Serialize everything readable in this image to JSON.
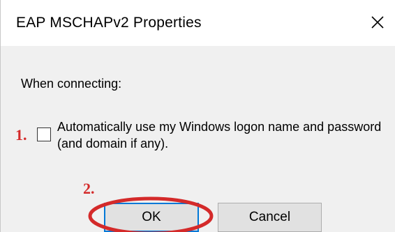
{
  "window": {
    "title": "EAP MSCHAPv2 Properties",
    "close_icon": "close-icon"
  },
  "section": {
    "label": "When connecting:"
  },
  "checkbox": {
    "label": "Automatically use my Windows logon name and password (and domain if any).",
    "checked": false
  },
  "annotations": {
    "step1": "1.",
    "step2": "2.",
    "color": "#d42a2a"
  },
  "buttons": {
    "ok_label": "OK",
    "cancel_label": "Cancel"
  },
  "colors": {
    "focus_border": "#0078d7",
    "highlight_ring": "#d42a2a"
  }
}
